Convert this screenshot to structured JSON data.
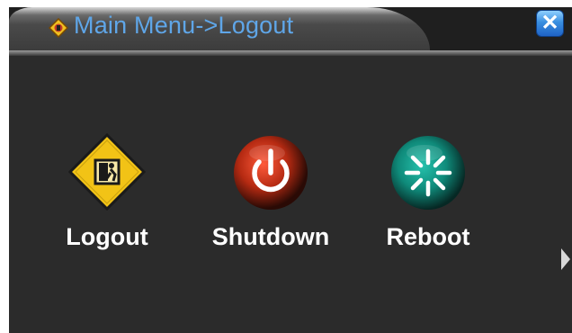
{
  "window": {
    "title": "Main Menu->Logout",
    "close_label": "✕"
  },
  "actions": [
    {
      "label": "Logout",
      "icon": "logout-exit-sign-icon"
    },
    {
      "label": "Shutdown",
      "icon": "power-icon"
    },
    {
      "label": "Reboot",
      "icon": "reboot-icon"
    }
  ],
  "colors": {
    "background": "#2b2b2b",
    "title_text": "#5fa6e8",
    "label_text": "#ffffff",
    "logout_sign": "#f2c316",
    "shutdown_button": "#b52a12",
    "reboot_button": "#0f8a7a",
    "close_button": "#3a8fe0"
  }
}
